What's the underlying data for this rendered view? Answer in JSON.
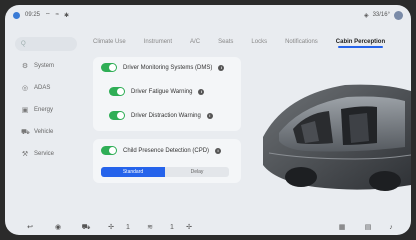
{
  "status_bar": {
    "time": "09:25",
    "right_text": "33/16°"
  },
  "sidebar": {
    "search_placeholder": "Q",
    "items": [
      {
        "label": "System",
        "icon": "gear-icon"
      },
      {
        "label": "ADAS",
        "icon": "car-assist-icon"
      },
      {
        "label": "Energy",
        "icon": "energy-icon"
      },
      {
        "label": "Vehicle",
        "icon": "vehicle-icon"
      },
      {
        "label": "Service",
        "icon": "service-icon"
      }
    ]
  },
  "tabs": [
    {
      "label": "Climate Use"
    },
    {
      "label": "Instrument"
    },
    {
      "label": "A/C"
    },
    {
      "label": "Seats"
    },
    {
      "label": "Locks"
    },
    {
      "label": "Notifications"
    },
    {
      "label": "Cabin Perception",
      "active": true
    }
  ],
  "settings": {
    "dms": {
      "label": "Driver Monitoring Systems (DMS)",
      "enabled": true
    },
    "fatigue": {
      "label": "Driver Fatigue Warning",
      "enabled": true
    },
    "distraction": {
      "label": "Driver Distraction Warning",
      "enabled": true
    },
    "cpd": {
      "label": "Child Presence Detection (CPD)",
      "enabled": true
    }
  },
  "cpd_mode": {
    "options": [
      "Standard",
      "Delay"
    ],
    "selected": "Standard"
  },
  "dock": {
    "temp_left": "1",
    "temp_right": "1"
  },
  "colors": {
    "accent": "#2563eb",
    "toggle_on": "#2fae56"
  }
}
